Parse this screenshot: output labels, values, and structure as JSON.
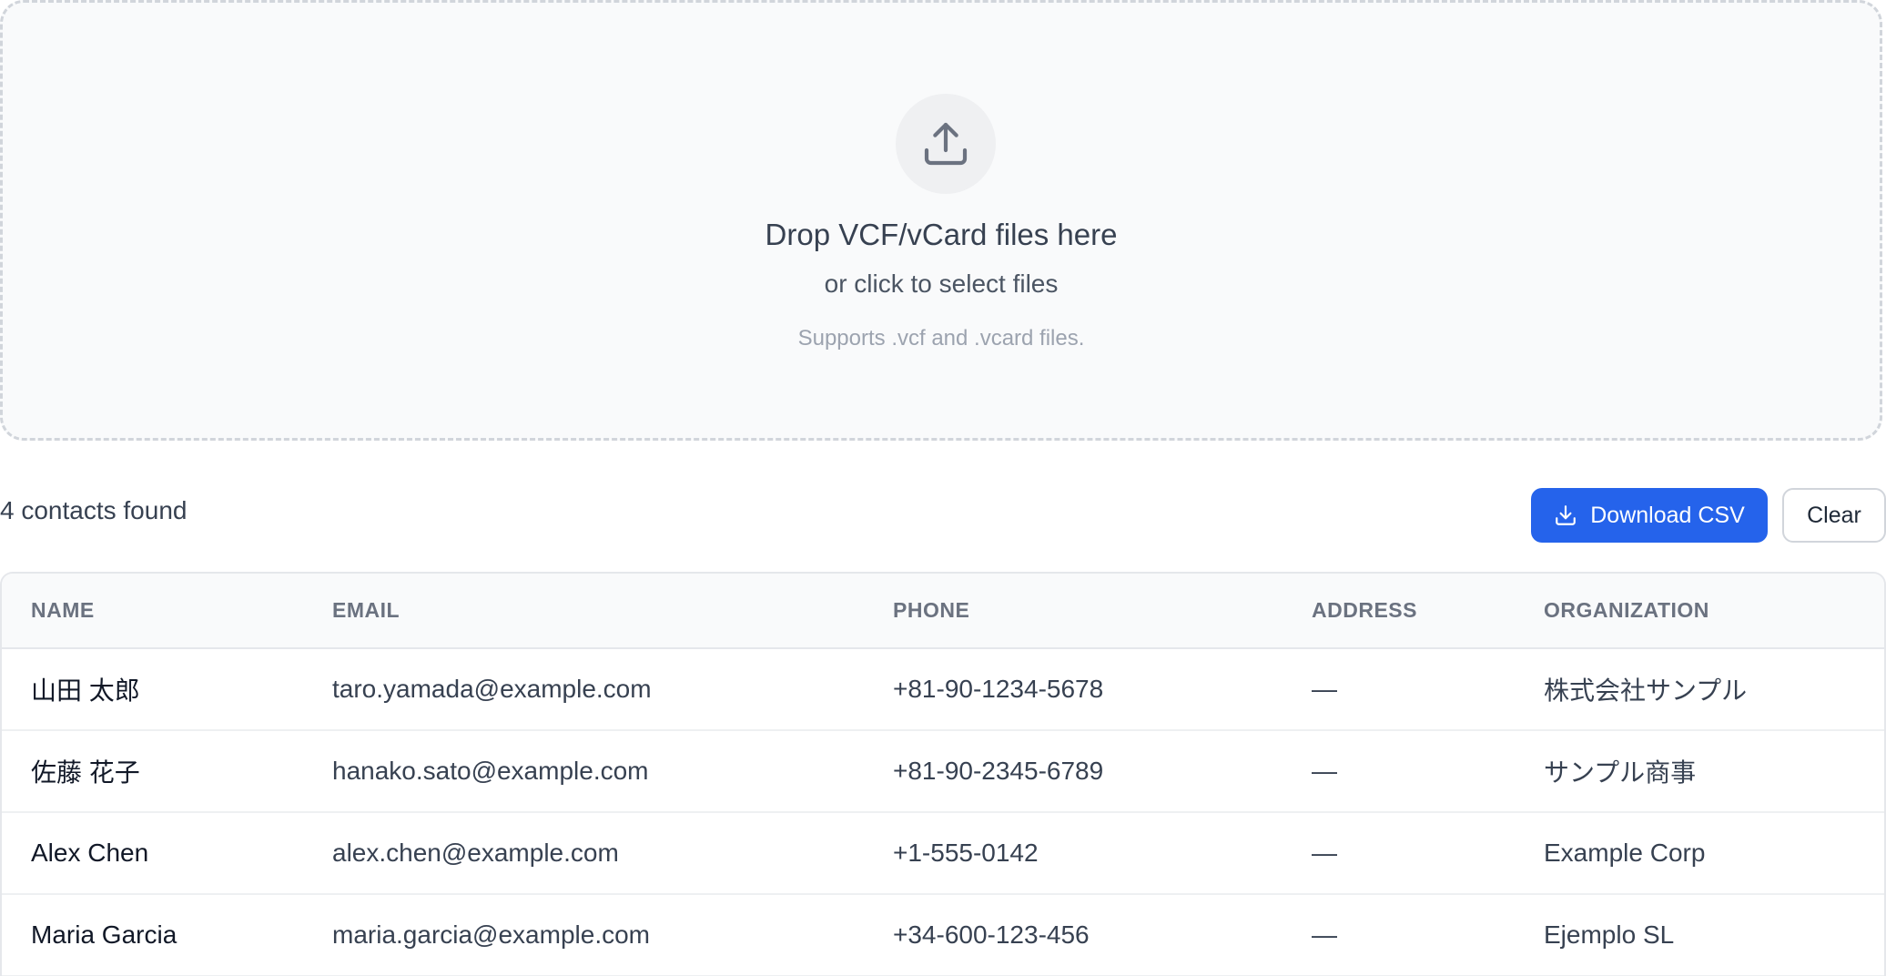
{
  "dropzone": {
    "title": "Drop VCF/vCard files here",
    "subtitle": "or click to select files",
    "hint": "Supports .vcf and .vcard files.",
    "icon": "upload-icon"
  },
  "toolbar": {
    "summary": "4 contacts found",
    "download_label": "Download CSV",
    "download_icon": "download-icon",
    "clear_label": "Clear",
    "accent_color": "#2563eb"
  },
  "table": {
    "columns": [
      "NAME",
      "EMAIL",
      "PHONE",
      "ADDRESS",
      "ORGANIZATION"
    ],
    "rows": [
      {
        "name": "山田 太郎",
        "email": "taro.yamada@example.com",
        "phone": "+81-90-1234-5678",
        "address": "—",
        "organization": "株式会社サンプル"
      },
      {
        "name": "佐藤 花子",
        "email": "hanako.sato@example.com",
        "phone": "+81-90-2345-6789",
        "address": "—",
        "organization": "サンプル商事"
      },
      {
        "name": "Alex Chen",
        "email": "alex.chen@example.com",
        "phone": "+1-555-0142",
        "address": "—",
        "organization": "Example Corp"
      },
      {
        "name": "Maria Garcia",
        "email": "maria.garcia@example.com",
        "phone": "+34-600-123-456",
        "address": "—",
        "organization": "Ejemplo SL"
      }
    ]
  }
}
